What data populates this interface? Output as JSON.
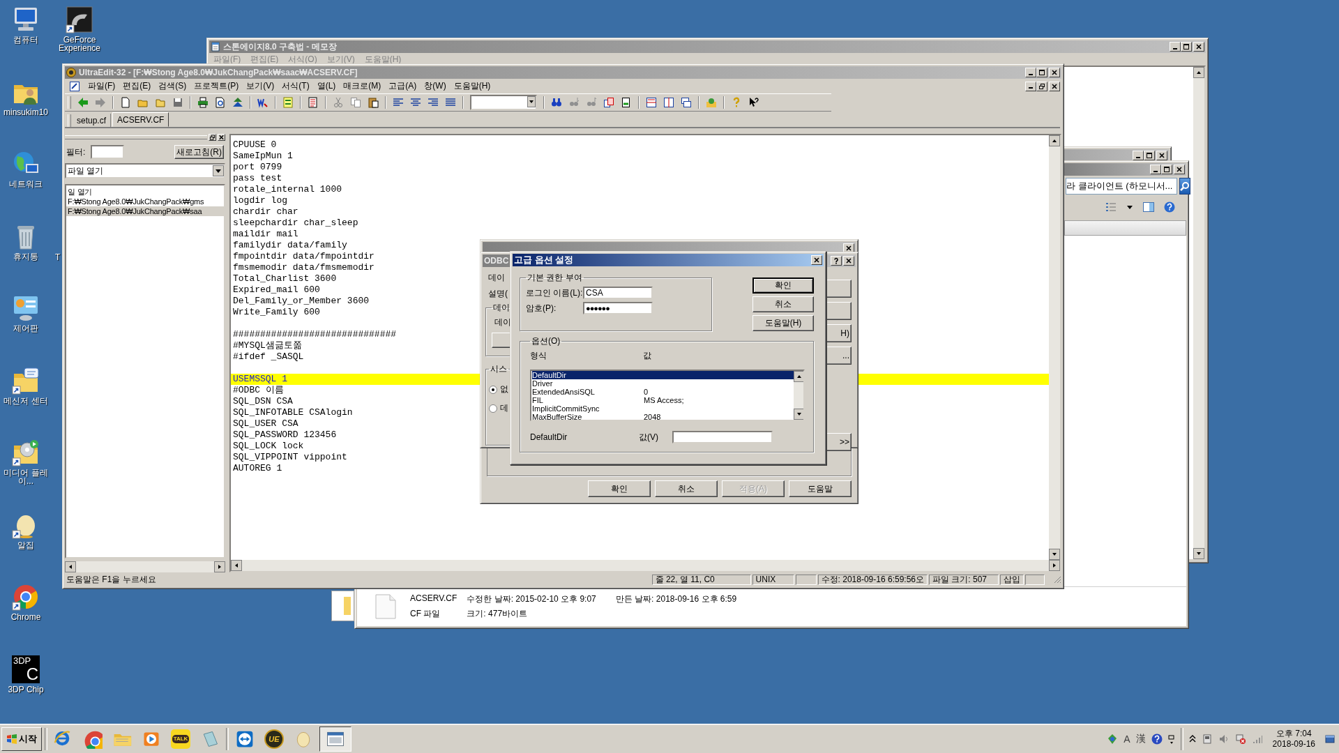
{
  "desktop": {
    "columns": [
      [
        {
          "kind": "computer",
          "label": "컴퓨터"
        },
        {
          "kind": "user",
          "label": "minsukim10"
        },
        {
          "kind": "network",
          "label": "네트워크"
        },
        {
          "kind": "bin",
          "label": "휴지통"
        },
        {
          "kind": "panel",
          "label": "제어판"
        },
        {
          "kind": "messenger",
          "label": "메신저 센터"
        },
        {
          "kind": "media",
          "label": "미디어 플레이..."
        },
        {
          "kind": "blob",
          "label": "알집"
        },
        {
          "kind": "chrome",
          "label": "Chrome"
        },
        {
          "kind": "chip",
          "label": "3DP Chip",
          "glyph": [
            "3DP",
            "C"
          ]
        }
      ],
      [
        {
          "kind": "geforce",
          "label": "GeForce Experience"
        },
        {
          "kind": "gap"
        },
        {
          "kind": "gap"
        },
        {
          "kind": "cut",
          "label": "T"
        }
      ]
    ]
  },
  "notepad": {
    "title": "스톤에이지8.0 구축법 - 메모장",
    "menu": [
      "파일(F)",
      "편집(E)",
      "서식(O)",
      "보기(V)",
      "도움말(H)"
    ]
  },
  "explorer": {
    "address": "라 클라이언트 (하모니서...",
    "details": {
      "name": "ACSERV.CF",
      "modified": "수정한 날짜: 2015-02-10 오후 9:07",
      "created": "만든 날짜: 2018-09-16 오후 6:59",
      "type": "CF 파일",
      "size": "크기: 477바이트"
    }
  },
  "ultraedit": {
    "title": "UltraEdit-32 - [F:₩Stong Age8.0₩JukChangPack₩saac₩ACSERV.CF]",
    "menu": [
      "파일(F)",
      "편집(E)",
      "검색(S)",
      "프로젝트(P)",
      "보기(V)",
      "서식(T)",
      "열(L)",
      "매크로(M)",
      "고급(A)",
      "창(W)",
      "도움말(H)"
    ],
    "tabs": [
      {
        "label": "setup.cf",
        "selected": false
      },
      {
        "label": "ACSERV.CF",
        "selected": true
      }
    ],
    "file_panel": {
      "filter_label": "필터:",
      "refresh": "새로고침(R)",
      "dropdown": "파일 열기",
      "items": [
        {
          "text": "일 열기",
          "selected": false
        },
        {
          "text": "F:₩Stong Age8.0₩JukChangPack₩gms",
          "selected": false
        },
        {
          "text": "F:₩Stong Age8.0₩JukChangPack₩saa",
          "selected": true
        }
      ]
    },
    "lines": [
      {
        "kind": "code",
        "text": "CPUUSE 0",
        "highlighted": false
      },
      {
        "kind": "code",
        "text": "SameIpMun 1",
        "highlighted": false
      },
      {
        "kind": "code",
        "text": "port 0799",
        "highlighted": false
      },
      {
        "kind": "code",
        "text": "pass test",
        "highlighted": false
      },
      {
        "kind": "code",
        "text": "rotale_internal 1000",
        "highlighted": false
      },
      {
        "kind": "code",
        "text": "logdir log",
        "highlighted": false
      },
      {
        "kind": "code",
        "text": "chardir char",
        "highlighted": false
      },
      {
        "kind": "code",
        "text": "sleepchardir char_sleep",
        "highlighted": false
      },
      {
        "kind": "code",
        "text": "maildir mail",
        "highlighted": false
      },
      {
        "kind": "code",
        "text": "familydir data/family",
        "highlighted": false
      },
      {
        "kind": "code",
        "text": "fmpointdir data/fmpointdir",
        "highlighted": false
      },
      {
        "kind": "code",
        "text": "fmsmemodir data/fmsmemodir",
        "highlighted": false
      },
      {
        "kind": "code",
        "text": "Total_Charlist 3600",
        "highlighted": false
      },
      {
        "kind": "code",
        "text": "Expired_mail 600",
        "highlighted": false
      },
      {
        "kind": "code",
        "text": "Del_Family_or_Member 3600",
        "highlighted": false
      },
      {
        "kind": "code",
        "text": "Write_Family 600",
        "highlighted": false
      },
      {
        "kind": "blank",
        "highlighted": false
      },
      {
        "kind": "code",
        "text": "##############################",
        "highlighted": false
      },
      {
        "kind": "code",
        "text": "#MYSQL샘긂토쫆",
        "highlighted": false
      },
      {
        "kind": "code",
        "text": "#ifdef _SASQL",
        "highlighted": false
      },
      {
        "kind": "blank",
        "highlighted": false
      },
      {
        "kind": "code",
        "text": "USEMSSQL 1",
        "highlighted": true
      },
      {
        "kind": "code",
        "text": "#ODBC 이름",
        "highlighted": false
      },
      {
        "kind": "code",
        "text": "SQL_DSN CSA",
        "highlighted": false
      },
      {
        "kind": "code",
        "text": "SQL_INFOTABLE CSAlogin",
        "highlighted": false
      },
      {
        "kind": "code",
        "text": "SQL_USER CSA",
        "highlighted": false
      },
      {
        "kind": "code",
        "text": "SQL_PASSWORD 123456",
        "highlighted": false
      },
      {
        "kind": "code",
        "text": "SQL_LOCK lock",
        "highlighted": false
      },
      {
        "kind": "code",
        "text": "SQL_VIPPOINT vippoint",
        "highlighted": false
      },
      {
        "kind": "code",
        "text": "AUTOREG 1",
        "highlighted": false
      }
    ],
    "status_bar": {
      "help": "도움말은 F1을 누르세요",
      "cells": [
        "줄 22, 열 11, C0",
        "UNIX",
        "수정: 2018-09-16 6:59:56오",
        "파일 크기: 507",
        "삽입"
      ]
    }
  },
  "odbc_manager": {
    "buttons": [
      {
        "label": "확인",
        "disabled": false
      },
      {
        "label": "취소",
        "disabled": false
      },
      {
        "label": "적용(A)",
        "disabled": true
      },
      {
        "label": "도움말",
        "disabled": false
      }
    ]
  },
  "odbc_setup": {
    "title": "ODBC",
    "labels": [
      "데이",
      "설명("
    ],
    "source_group": {
      "title": "데이",
      "label": "데이"
    },
    "system_group": {
      "title": "시스",
      "options": [
        {
          "label": "없",
          "selected": true
        },
        {
          "label": "데",
          "selected": false
        }
      ]
    },
    "side_buttons": [
      "H)",
      "...",
      ">>"
    ]
  },
  "advanced": {
    "title": "고급 옵션 설정",
    "grant_group": "기본 권한 부여",
    "login_label": "로그인 이름(L):",
    "login": "CSA",
    "password_label": "암호(P):",
    "password": "●●●●●●",
    "buttons": [
      "확인",
      "취소",
      "도움말(H)"
    ],
    "options_group": "옵션(O)",
    "columns": [
      "형식",
      "값"
    ],
    "options": [
      {
        "name": "DefaultDir",
        "selected": true
      },
      {
        "name": "Driver",
        "selected": false
      },
      {
        "name": "ExtendedAnsiSQL",
        "value": "0",
        "selected": false
      },
      {
        "name": "FIL",
        "value": "MS Access;",
        "selected": false
      },
      {
        "name": "ImplicitCommitSync",
        "selected": false
      },
      {
        "name": "MaxBufferSize",
        "value": "2048",
        "selected": false
      }
    ],
    "current_name": "DefaultDir",
    "value_label": "값(V)"
  },
  "taskbar": {
    "start": "시작",
    "apps": [
      {
        "kind": "ie",
        "selected": false
      },
      {
        "kind": "chrome",
        "selected": false
      },
      {
        "kind": "folder",
        "selected": false
      },
      {
        "kind": "media",
        "selected": false
      },
      {
        "kind": "talk",
        "glyph": "TALK",
        "selected": false
      },
      {
        "kind": "notebook",
        "selected": false
      },
      {
        "kind": "teamviewer",
        "selected": false
      },
      {
        "kind": "ue",
        "glyph": "UE",
        "selected": false
      },
      {
        "kind": "blob",
        "selected": false
      },
      {
        "kind": "window",
        "selected": true
      }
    ],
    "tray": {
      "ime_latin": "A",
      "ime_hanja": "漢",
      "time": "오후 7:04",
      "date": "2018-09-16"
    }
  }
}
